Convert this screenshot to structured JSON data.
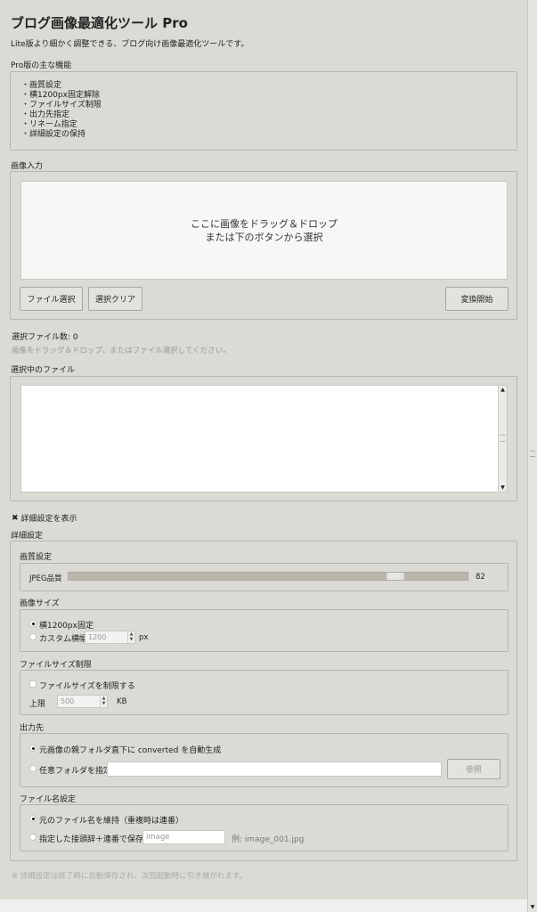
{
  "title": "ブログ画像最適化ツール Pro",
  "subtitle": "Lite版より細かく調整できる、ブログ向け画像最適化ツールです。",
  "features": {
    "label": "Pro版の主な機能",
    "items": [
      "・画質設定",
      "・横1200px固定解除",
      "・ファイルサイズ制限",
      "・出力先指定",
      "・リネーム指定",
      "・詳細設定の保持"
    ]
  },
  "input": {
    "label": "画像入力",
    "drop_line1": "ここに画像をドラッグ＆ドロップ",
    "drop_line2": "または下のボタンから選択",
    "select_button": "ファイル選択",
    "clear_button": "選択クリア",
    "convert_button": "変換開始"
  },
  "status": {
    "count": "選択ファイル数: 0",
    "hint": "画像をドラッグ＆ドロップ、またはファイル選択してください。"
  },
  "selected": {
    "label": "選択中のファイル"
  },
  "advanced_toggle": {
    "label": "詳細設定を表示",
    "checked": true
  },
  "advanced": {
    "label": "詳細設定",
    "quality": {
      "label": "画質設定",
      "slider_label": "JPEG品質",
      "value": "82",
      "min": 0,
      "max": 100
    },
    "size": {
      "label": "画像サイズ",
      "fixed": "横1200px固定",
      "custom": "カスタム横幅",
      "custom_value": "1200",
      "unit": "px"
    },
    "filesize": {
      "label": "ファイルサイズ制限",
      "checkbox": "ファイルサイズを制限する",
      "limit_label": "上限",
      "limit_value": "500",
      "unit": "KB"
    },
    "output": {
      "label": "出力先",
      "auto": "元画像の親フォルダ直下に converted を自動生成",
      "custom": "任意フォルダを指定",
      "path": "",
      "browse": "参照"
    },
    "filename": {
      "label": "ファイル名設定",
      "keep": "元のファイル名を維持（重複時は連番）",
      "prefix": "指定した接頭辞＋連番で保存",
      "prefix_placeholder": "image",
      "example": "例: image_001.jpg"
    }
  },
  "note": "※ 詳細設定は終了時に自動保存され、次回起動時に引き継がれます。"
}
